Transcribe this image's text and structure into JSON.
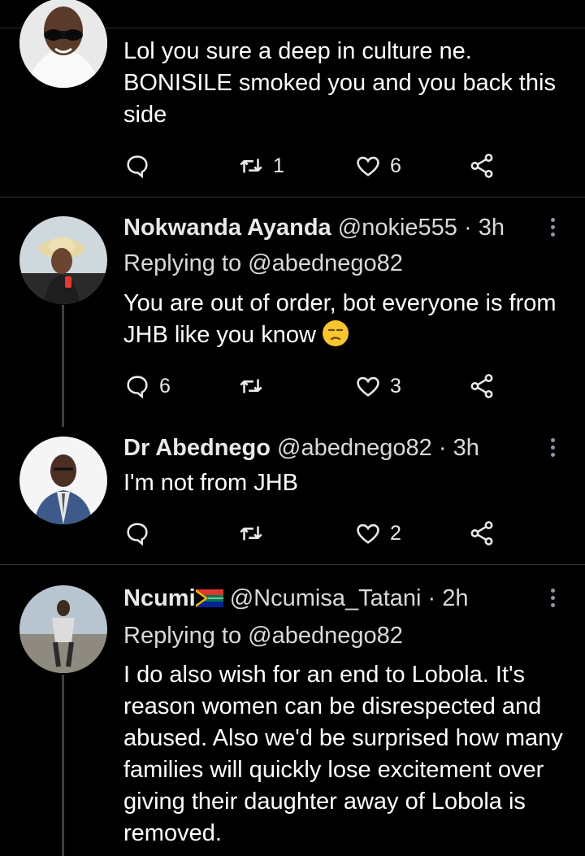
{
  "tweets": [
    {
      "body": "Lol you sure a deep in culture ne. BONISILE smoked you and you back this side",
      "actions": {
        "replies": "",
        "retweets": "1",
        "likes": "6"
      }
    },
    {
      "name": "Nokwanda Ayanda",
      "handle": "@nokie555",
      "time": "3h",
      "replying_prefix": "Replying to",
      "replying_handle": "@abednego82",
      "body": "You are out of order, bot everyone is from JHB like you know",
      "emoji": "unamused-face",
      "actions": {
        "replies": "6",
        "retweets": "",
        "likes": "3"
      }
    },
    {
      "name": "Dr Abednego",
      "handle": "@abednego82",
      "time": "3h",
      "body": "I'm not from JHB",
      "actions": {
        "replies": "",
        "retweets": "",
        "likes": "2"
      }
    },
    {
      "name": "Ncumi",
      "flag": "south-africa-flag",
      "handle": "@Ncumisa_Tatani",
      "time": "2h",
      "replying_prefix": "Replying to",
      "replying_handle": "@abednego82",
      "body": "I do also wish for an end to Lobola. It's reason women can be disrespected and abused. Also we'd be surprised how many families will quickly lose excitement over giving their daughter away of Lobola is removed."
    }
  ],
  "separator": "·",
  "colors": {
    "background": "#000000",
    "divider": "#2f3336",
    "icon": "#e7e9ea"
  }
}
